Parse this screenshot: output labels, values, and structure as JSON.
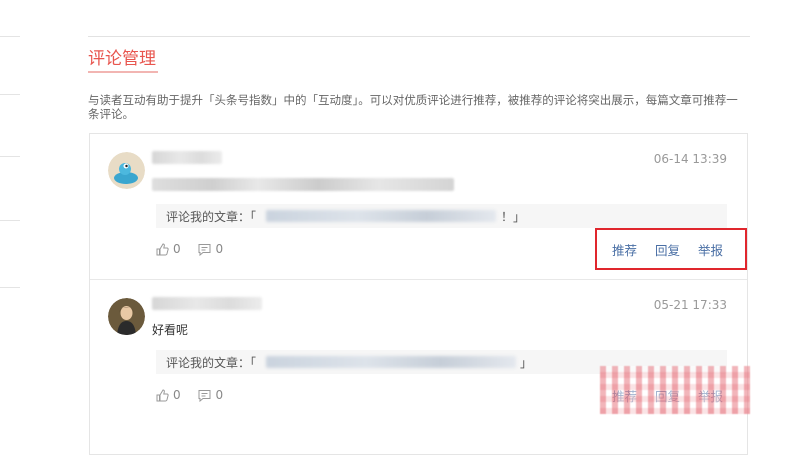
{
  "section": {
    "title": "评论管理",
    "description": "与读者互动有助于提升「头条号指数」中的「互动度」。可以对优质评论进行推荐，被推荐的评论将突出展示，每篇文章可推荐一条评论。"
  },
  "comments": [
    {
      "time": "06-14 13:39",
      "content": "",
      "article_label": "评论我的文章：「",
      "article_end": "！」",
      "likes": "0",
      "replies": "0",
      "actions": {
        "recommend": "推荐",
        "reply": "回复",
        "report": "举报"
      }
    },
    {
      "time": "05-21 17:33",
      "content": "好看呢",
      "article_label": "评论我的文章：「",
      "article_end": "」",
      "likes": "0",
      "replies": "0",
      "actions": {
        "recommend": "推荐",
        "reply": "回复",
        "report": "举报"
      }
    }
  ],
  "colors": {
    "accent": "#e8554e",
    "link": "#4a6fa5",
    "highlight": "#e0262d"
  }
}
